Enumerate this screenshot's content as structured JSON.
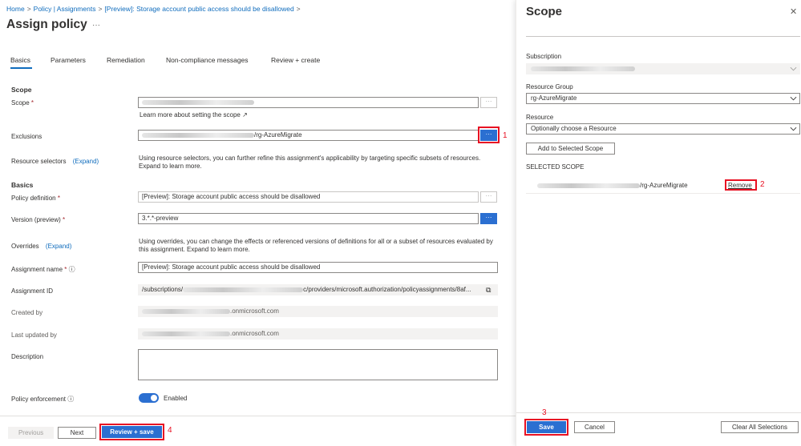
{
  "breadcrumb": [
    "Home",
    "Policy | Assignments",
    "[Preview]: Storage account public access should be disallowed"
  ],
  "page_title": "Assign policy",
  "title_more": "···",
  "tabs": [
    "Basics",
    "Parameters",
    "Remediation",
    "Non-compliance messages",
    "Review + create"
  ],
  "scope_section": {
    "heading": "Scope",
    "scope_label": "Scope",
    "scope_link": "Learn more about setting the scope",
    "exclusions_label": "Exclusions",
    "exclusions_value": "/rg-AzureMigrate",
    "resource_selectors_label": "Resource selectors",
    "expand": "(Expand)",
    "resource_selectors_desc": "Using resource selectors, you can further refine this assignment's applicability by targeting specific subsets of resources. Expand to learn more."
  },
  "basics_section": {
    "heading": "Basics",
    "policy_definition_label": "Policy definition",
    "policy_definition_value": "[Preview]: Storage account public access should be disallowed",
    "version_label": "Version (preview)",
    "version_value": "3.*.*-preview",
    "overrides_label": "Overrides",
    "overrides_desc": "Using overrides, you can change the effects or referenced versions of definitions for all or a subset of resources evaluated by this assignment. Expand to learn more.",
    "assignment_name_label": "Assignment name",
    "assignment_name_value": "[Preview]: Storage account public access should be disallowed",
    "assignment_id_label": "Assignment ID",
    "assignment_id_prefix": "/subscriptions/",
    "assignment_id_suffix": "c/providers/microsoft.authorization/policyassignments/8af...",
    "created_by_label": "Created by",
    "created_by_value": ".onmicrosoft.com",
    "last_updated_label": "Last updated by",
    "last_updated_value": ".onmicrosoft.com",
    "description_label": "Description",
    "policy_enforcement_label": "Policy enforcement",
    "policy_enforcement_value": "Enabled",
    "required_mark": "*",
    "info_glyph": "ⓘ"
  },
  "footer": {
    "previous": "Previous",
    "next": "Next",
    "review_save": "Review + save"
  },
  "dots": "···",
  "annotations": [
    "1",
    "2",
    "3",
    "4"
  ],
  "panel": {
    "title": "Scope",
    "close": "✕",
    "subscription_label": "Subscription",
    "resource_group_label": "Resource Group",
    "resource_group_value": "rg-AzureMigrate",
    "resource_label": "Resource",
    "resource_placeholder": "Optionally choose a Resource",
    "add_button": "Add to Selected Scope",
    "selected_scope_heading": "SELECTED SCOPE",
    "selected_scope_value": "/rg-AzureMigrate",
    "remove_link": "Remove",
    "save_button": "Save",
    "cancel_button": "Cancel",
    "clear_button": "Clear All Selections"
  },
  "colors": {
    "accent": "#2b6fd1",
    "link": "#0f6cbd",
    "annotation": "#e81123"
  }
}
